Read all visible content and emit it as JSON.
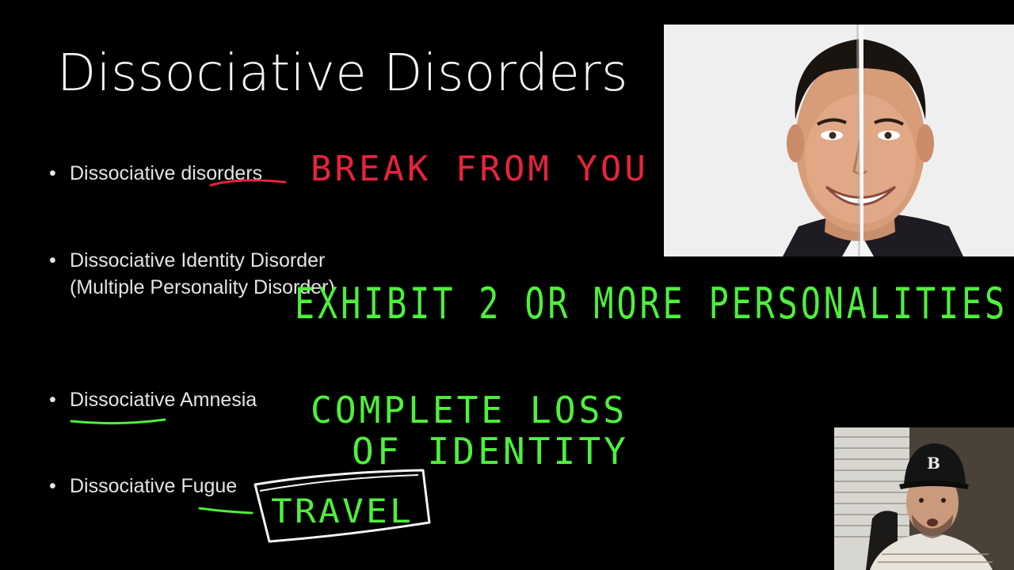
{
  "slide": {
    "title": "Dissociative Disorders",
    "bullet_symbol": "•",
    "bullets": [
      {
        "text": "Dissociative disorders"
      },
      {
        "text": "Dissociative Identity Disorder (Multiple Personality Disorder)"
      },
      {
        "text": "Dissociative Amnesia"
      },
      {
        "text": "Dissociative Fugue"
      }
    ]
  },
  "annotations": {
    "break": "BREAK FROM YOU",
    "exhibit": "EXHIBIT 2 OR MORE   PERSONALITIES",
    "complete1": "COMPLETE LOSS",
    "complete2": "OF   IDENTITY",
    "travel": "TRAVEL"
  },
  "colors": {
    "background": "#000000",
    "text": "#e4e4e4",
    "ink_red": "#e8233c",
    "ink_green": "#4ef03c",
    "ink_white": "#f2f2f2"
  },
  "images": {
    "split_face_photo": "split-face-portrait",
    "webcam": "presenter-webcam"
  }
}
